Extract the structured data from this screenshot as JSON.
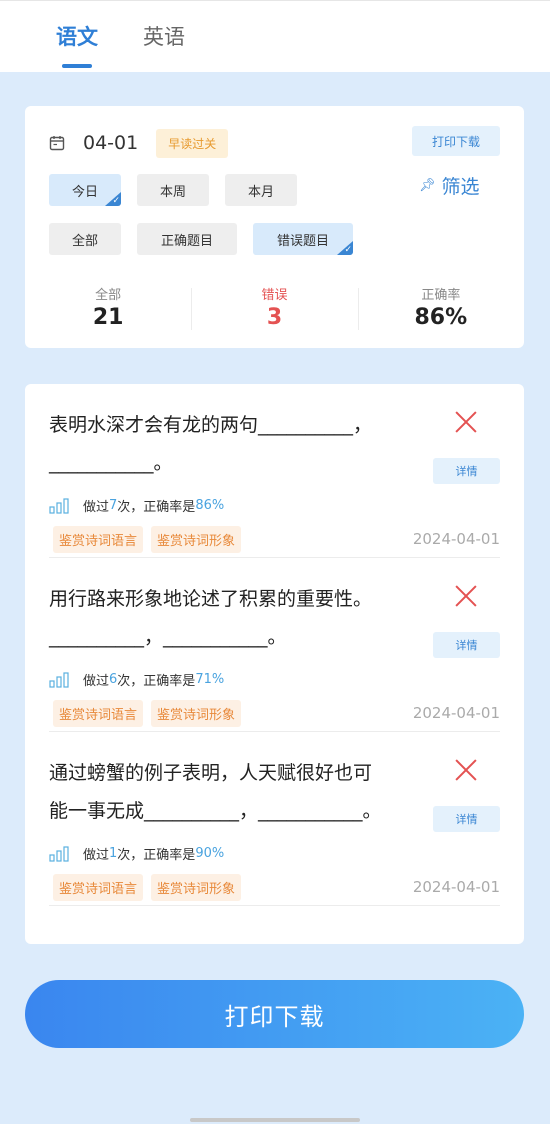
{
  "tabs": [
    {
      "label": "语文",
      "active": true
    },
    {
      "label": "英语",
      "active": false
    }
  ],
  "filter": {
    "date": "04-01",
    "badge": "早读过关",
    "print_label": "打印下载",
    "range_chips": [
      "今日",
      "本周",
      "本月"
    ],
    "active_range": "今日",
    "filter_label": "筛选",
    "type_chips": [
      "全部",
      "正确题目",
      "错误题目"
    ],
    "active_type": "错误题目"
  },
  "stats": [
    {
      "label": "全部",
      "value": "21"
    },
    {
      "label": "错误",
      "value": "3"
    },
    {
      "label": "正确率",
      "value": "86%"
    }
  ],
  "questions": [
    {
      "line1": "表明水深才会有龙的两句__________，",
      "line2": "___________。",
      "detail": "详情",
      "meta_prefix": "做过",
      "count": "7",
      "meta_mid": "次，正确率是",
      "rate": "86%",
      "tags": [
        "鉴赏诗词语言",
        "鉴赏诗词形象"
      ],
      "date": "2024-04-01"
    },
    {
      "line1": "用行路来形象地论述了积累的重要性。",
      "line2": "__________，___________。",
      "detail": "详情",
      "meta_prefix": "做过",
      "count": "6",
      "meta_mid": "次，正确率是",
      "rate": "71%",
      "tags": [
        "鉴赏诗词语言",
        "鉴赏诗词形象"
      ],
      "date": "2024-04-01"
    },
    {
      "line1": "通过螃蟹的例子表明，人天赋很好也可",
      "line2": "能一事无成__________，___________。",
      "detail": "详情",
      "meta_prefix": "做过",
      "count": "1",
      "meta_mid": "次，正确率是",
      "rate": "90%",
      "tags": [
        "鉴赏诗词语言",
        "鉴赏诗词形象"
      ],
      "date": "2024-04-01"
    }
  ],
  "bottom_button": "打印下载",
  "colors": {
    "accent": "#2f7fd6",
    "error": "#e45252",
    "badge": "#e79a2e",
    "tag": "#e8893a"
  },
  "icons": {
    "calendar": "calendar-icon",
    "filter": "pin-icon",
    "bars": "signal-bars-icon",
    "close": "close-icon"
  }
}
